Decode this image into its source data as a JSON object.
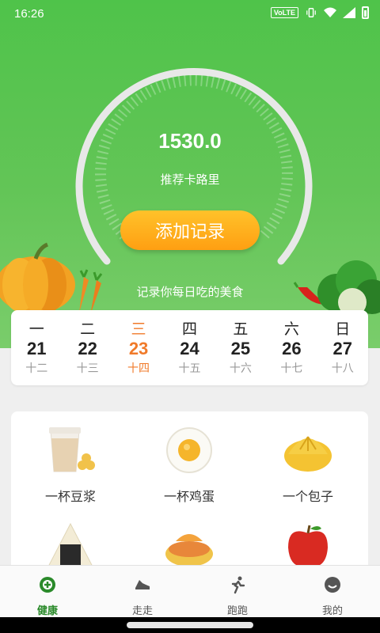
{
  "status_bar": {
    "time": "16:26",
    "volte": "VoLTE",
    "icons": [
      "vibrate-icon",
      "wifi-icon",
      "signal-icon",
      "battery-icon"
    ]
  },
  "hero": {
    "calories_value": "1530.0",
    "calories_label": "推荐卡路里",
    "add_button": "添加记录",
    "hint": "记录你每日吃的美食",
    "colors": {
      "green": "#5cc450",
      "button": "#ffae1a",
      "active": "#f07a2a"
    }
  },
  "week": [
    {
      "weekday": "一",
      "date": "21",
      "lunar": "十二"
    },
    {
      "weekday": "二",
      "date": "22",
      "lunar": "十三"
    },
    {
      "weekday": "三",
      "date": "23",
      "lunar": "十四",
      "active": true
    },
    {
      "weekday": "四",
      "date": "24",
      "lunar": "十五"
    },
    {
      "weekday": "五",
      "date": "25",
      "lunar": "十六"
    },
    {
      "weekday": "六",
      "date": "26",
      "lunar": "十七"
    },
    {
      "weekday": "日",
      "date": "27",
      "lunar": "十八"
    }
  ],
  "foods": [
    {
      "name": "一杯豆浆",
      "icon": "soy-milk-icon"
    },
    {
      "name": "一杯鸡蛋",
      "icon": "egg-icon"
    },
    {
      "name": "一个包子",
      "icon": "bun-icon"
    },
    {
      "name": "",
      "icon": "rice-ball-icon"
    },
    {
      "name": "",
      "icon": "dish-icon"
    },
    {
      "name": "",
      "icon": "apple-icon"
    }
  ],
  "tabs": [
    {
      "label": "健康",
      "icon": "health-icon",
      "active": true
    },
    {
      "label": "走走",
      "icon": "shoe-icon"
    },
    {
      "label": "跑跑",
      "icon": "runner-icon"
    },
    {
      "label": "我的",
      "icon": "profile-icon"
    }
  ]
}
